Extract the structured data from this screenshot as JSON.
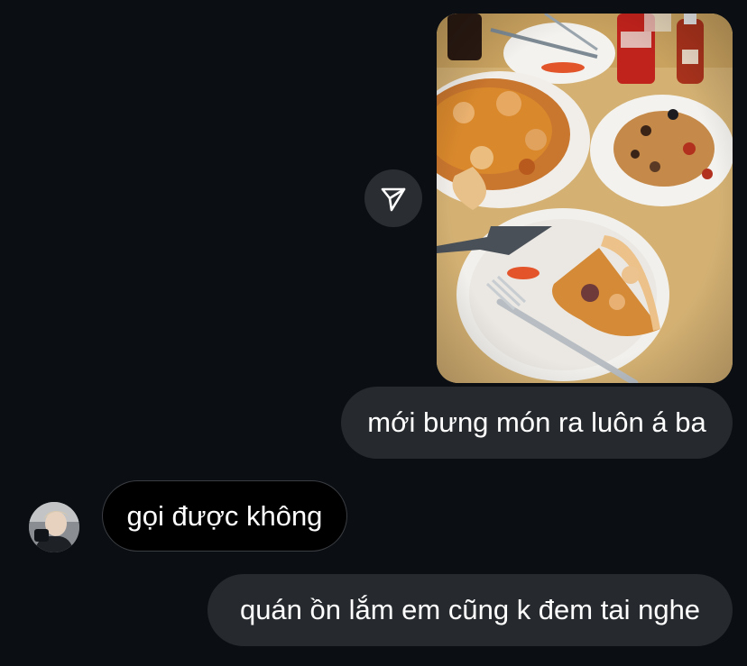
{
  "messages": [
    {
      "direction": "sent",
      "text": "mới bưng món ra luôn á ba"
    },
    {
      "direction": "received",
      "text": "gọi được không"
    },
    {
      "direction": "sent",
      "text": "quán ồn lắm em cũng k đem tai nghe"
    }
  ],
  "attachment": {
    "type": "photo",
    "description_icon": "food-photo"
  },
  "icons": {
    "share": "send-paper-plane-icon",
    "avatar": "contact-avatar"
  },
  "colors": {
    "background": "#0b0f14",
    "sent_bubble": "#262a2e",
    "received_bubble": "#000000",
    "text": "#ffffff"
  }
}
